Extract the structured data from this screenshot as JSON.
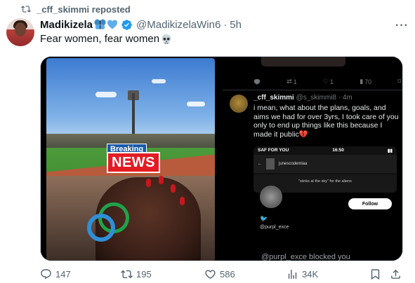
{
  "repost": {
    "text": "_cff_skimmi reposted"
  },
  "author": {
    "display_name": "Madikizela",
    "handle": "@MadikizelaWin6",
    "separator": "·",
    "time": "5h",
    "verified": true
  },
  "tweet": {
    "text": "Fear women, fear women"
  },
  "media": {
    "left": {
      "breaking_label": "Breaking",
      "news_label": "NEWS"
    },
    "right": {
      "actions": {
        "replies": "",
        "reposts": "1",
        "likes": "1",
        "views": "70"
      },
      "reply_author": "_cff_skimmi",
      "reply_handle": "@s_skimmi8 · 4m",
      "reply_text": "i mean, what about the plans, goals, and aims we had for over 3yrs, I took care of you only to end up things like this because I made it public",
      "embed_status_left": "SAF FOR YOU",
      "embed_status_time": "16:50",
      "embed_username": "junescodemlaa",
      "embed_quote": "\"winks at the sky\" for the aliens",
      "follow_label": "Follow",
      "embed_user": "@purpl_exce",
      "bottom_text": "@purpl_exce blocked you"
    }
  },
  "actions": {
    "replies": "147",
    "reposts": "195",
    "likes": "586",
    "views": "34K"
  },
  "colors": {
    "verified_blue": "#1d9bf0",
    "muted_text": "#536471",
    "news_red": "#e31b23",
    "breaking_blue": "#1959a8"
  },
  "icons": [
    "repost-icon",
    "butterfly-emoji-icon",
    "blue-heart-emoji-icon",
    "verified-badge-icon",
    "more-icon",
    "skull-emoji-icon",
    "reply-icon",
    "like-icon",
    "views-icon",
    "bookmark-icon",
    "share-icon"
  ]
}
